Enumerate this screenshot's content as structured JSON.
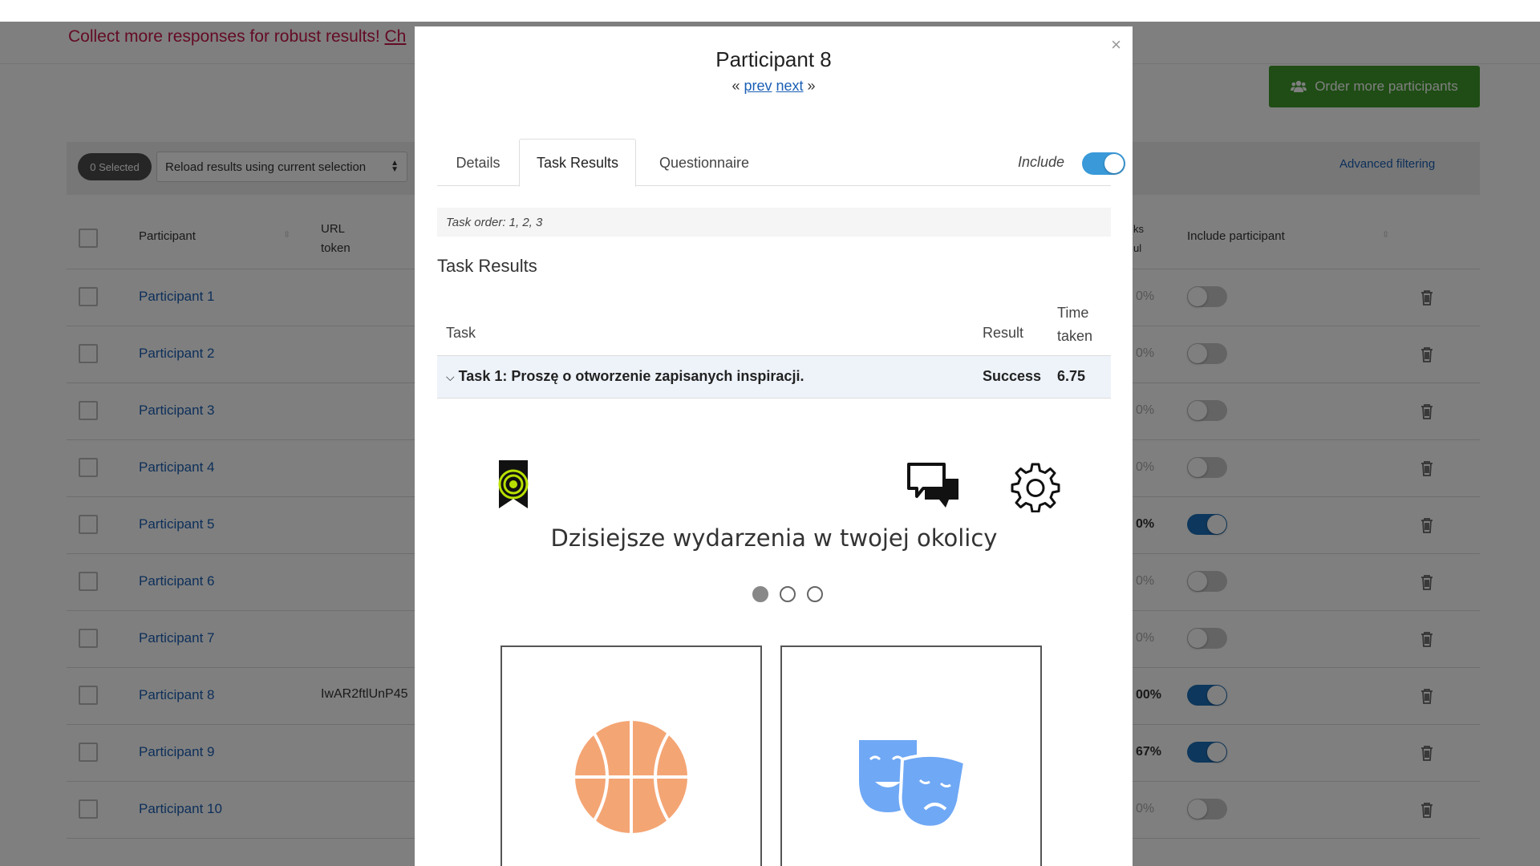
{
  "banner": {
    "text": "Collect more responses for robust results! ",
    "link": "Ch"
  },
  "order_button": {
    "label": "Order more participants"
  },
  "toolbar": {
    "selected": "0 Selected",
    "reload_select": "Reload results using current selection",
    "advanced_filtering": "Advanced filtering"
  },
  "table": {
    "headers": {
      "participant": "Participant",
      "url_token": "URL\ntoken",
      "tasks_successful": "ks\nul",
      "include_participant": "Include participant"
    },
    "rows": [
      {
        "name": "Participant 1",
        "token": "",
        "pct": "0%",
        "included": false
      },
      {
        "name": "Participant 2",
        "token": "",
        "pct": "0%",
        "included": false
      },
      {
        "name": "Participant 3",
        "token": "",
        "pct": "0%",
        "included": false
      },
      {
        "name": "Participant 4",
        "token": "",
        "pct": "0%",
        "included": false
      },
      {
        "name": "Participant 5",
        "token": "",
        "pct": "0%",
        "included": true
      },
      {
        "name": "Participant 6",
        "token": "",
        "pct": "0%",
        "included": false
      },
      {
        "name": "Participant 7",
        "token": "",
        "pct": "0%",
        "included": false
      },
      {
        "name": "Participant 8",
        "token": "IwAR2ftlUnP45",
        "pct": "00%",
        "included": true
      },
      {
        "name": "Participant 9",
        "token": "",
        "pct": "67%",
        "included": true
      },
      {
        "name": "Participant 10",
        "token": "",
        "pct": "0%",
        "included": false
      }
    ]
  },
  "modal": {
    "title": "Participant 8",
    "nav": {
      "prev_arrow": "«",
      "prev": "prev",
      "next": "next",
      "next_arrow": "»"
    },
    "close": "×",
    "tabs": [
      "Details",
      "Task Results",
      "Questionnaire"
    ],
    "active_tab": "Task Results",
    "include_label": "Include",
    "include_on": true,
    "task_order": "Task order: 1, 2, 3",
    "section_heading": "Task Results",
    "columns": {
      "task": "Task",
      "result": "Result",
      "time": "Time taken"
    },
    "task": {
      "name": "Task 1: Proszę o otworzenie zapisanych inspiracji.",
      "result": "Success",
      "time": "6.75"
    },
    "preview": {
      "title": "Dzisiejsze wydarzenia w twojej okolicy",
      "dots": 3,
      "active_dot": 0,
      "icons": [
        "bookmark-target-icon",
        "chat-bubbles-icon",
        "gear-icon",
        "basketball-icon",
        "theater-masks-icon"
      ]
    }
  },
  "colors": {
    "accent_blue": "#1a5fb4",
    "toggle_on": "#1b6fb8",
    "banner_red": "#c8174b",
    "order_green": "#3e9b2a",
    "task_row_bg": "#eef3fa"
  }
}
